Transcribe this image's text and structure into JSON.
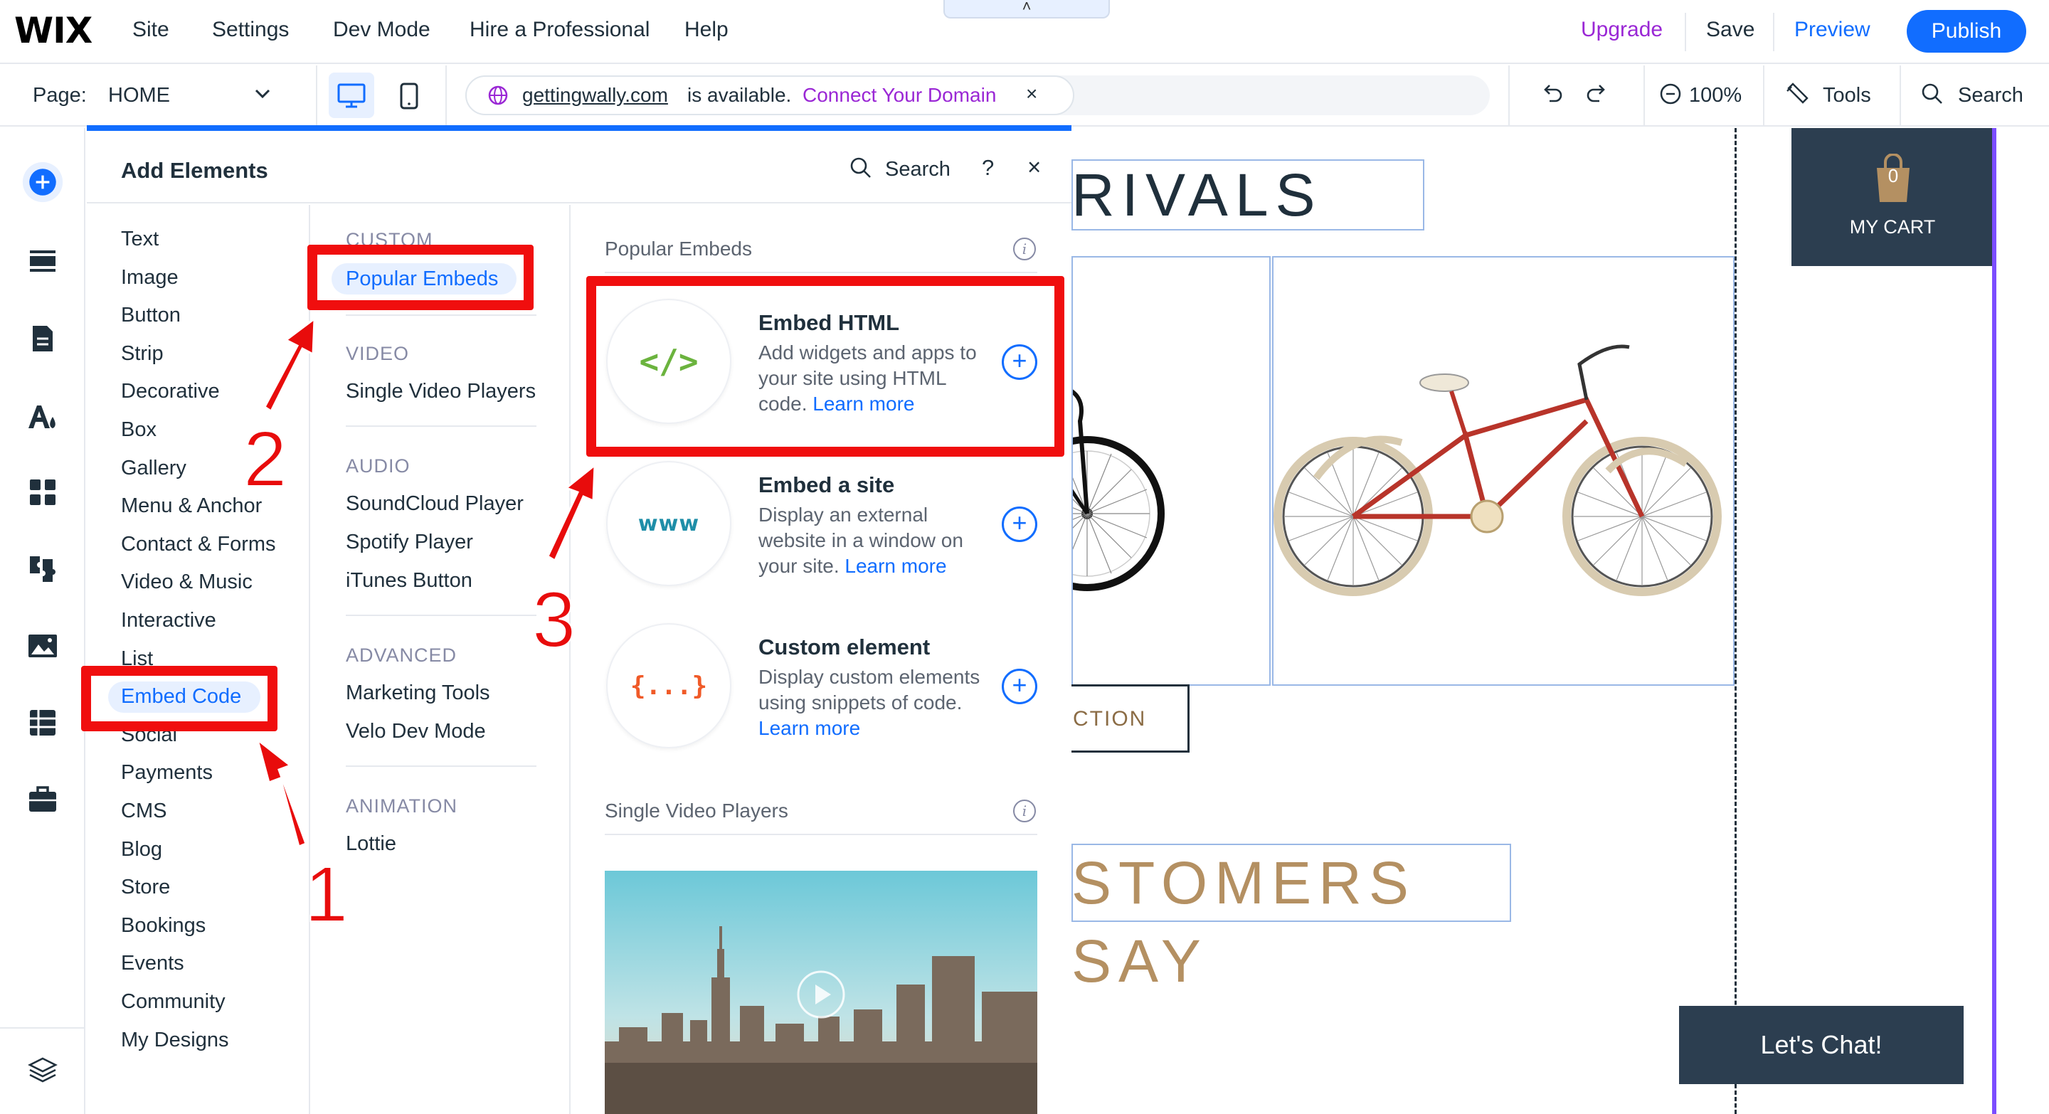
{
  "topbar": {
    "logo": "WIX",
    "menu": [
      "Site",
      "Settings",
      "Dev Mode",
      "Hire a Professional",
      "Help"
    ],
    "upgrade": "Upgrade",
    "save": "Save",
    "preview": "Preview",
    "publish": "Publish",
    "pull_tab_glyph": "˄"
  },
  "bar2": {
    "page_label": "Page:",
    "page_value": "HOME",
    "domain": "gettingwally.com",
    "domain_status": "is available.",
    "connect_domain": "Connect Your Domain",
    "close": "×",
    "zoom": "100%",
    "tools": "Tools",
    "search": "Search"
  },
  "rail": {
    "icons": [
      "add-elements-icon",
      "sections-icon",
      "pages-icon",
      "theme-icon",
      "apps-icon",
      "business-icon",
      "media-icon",
      "cms-icon",
      "portfolio-icon",
      "layers-icon"
    ]
  },
  "panel": {
    "title": "Add Elements",
    "search": "Search",
    "help": "?",
    "close": "×",
    "categories": [
      "Text",
      "Image",
      "Button",
      "Strip",
      "Decorative",
      "Box",
      "Gallery",
      "Menu & Anchor",
      "Contact & Forms",
      "Video & Music",
      "Interactive",
      "List",
      "Embed Code",
      "Social",
      "Payments",
      "CMS",
      "Blog",
      "Store",
      "Bookings",
      "Events",
      "Community",
      "My Designs"
    ],
    "active_category": "Embed Code",
    "sub": {
      "custom_h": "CUSTOM",
      "popular": "Popular Embeds",
      "video_h": "VIDEO",
      "single_video": "Single Video Players",
      "audio_h": "AUDIO",
      "soundcloud": "SoundCloud Player",
      "spotify": "Spotify Player",
      "itunes": "iTunes Button",
      "advanced_h": "ADVANCED",
      "marketing": "Marketing Tools",
      "velo": "Velo Dev Mode",
      "animation_h": "ANIMATION",
      "lottie": "Lottie"
    },
    "popular_heading": "Popular Embeds",
    "embeds": [
      {
        "icon_text": "</>",
        "title": "Embed HTML",
        "desc": "Add widgets and apps to your site using HTML code.",
        "link": "Learn more"
      },
      {
        "icon_text": "www",
        "title": "Embed a site",
        "desc": "Display an external website in a window on your site.",
        "link": "Learn more"
      },
      {
        "icon_text": "{...}",
        "title": "Custom element",
        "desc": "Display custom elements using snippets of code.",
        "link": "Learn more"
      }
    ],
    "video_heading": "Single Video Players",
    "info": "i",
    "plus": "+"
  },
  "canvas": {
    "arrivals": "RIVALS",
    "cta": "CTION",
    "customers": "STOMERS SAY",
    "cart_label": "MY CART",
    "cart_count": "0",
    "chat": "Let's Chat!"
  },
  "annotations": {
    "n1": "1",
    "n2": "2",
    "n3": "3"
  },
  "colors": {
    "accent": "#116dff",
    "upgrade": "#9a27d5",
    "annotation_red": "#f00e0e",
    "site_dark": "#2c3e50",
    "site_gold": "#b49062"
  }
}
